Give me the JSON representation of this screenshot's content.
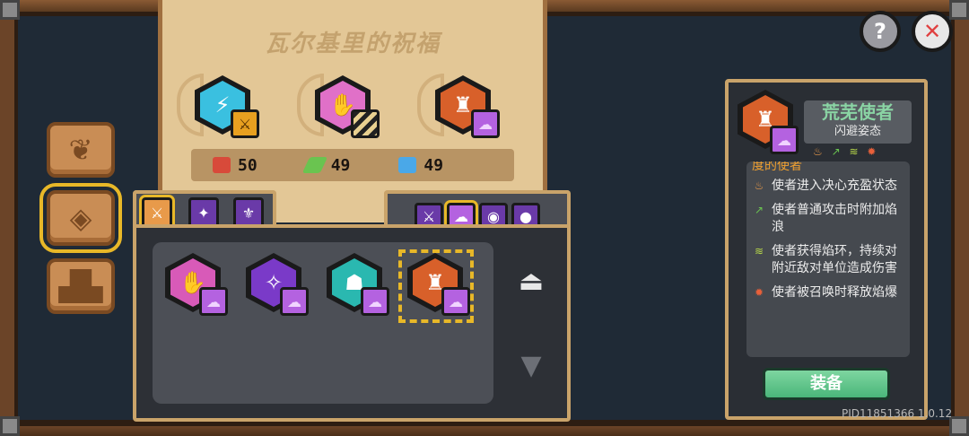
{
  "blessing": {
    "title": "瓦尔基里的祝福",
    "slots": [
      {
        "icon": "lightning-hex-icon",
        "badge": "sword-badge-icon"
      },
      {
        "icon": "pink-hand-hex-icon",
        "badge": "striped-badge-icon"
      },
      {
        "icon": "fire-envoy-hex-icon",
        "badge": "purple-cloud-badge-icon"
      }
    ],
    "stats": [
      {
        "icon": "red-gem-icon",
        "value": "50",
        "color": "#d84a3a"
      },
      {
        "icon": "green-leaf-icon",
        "value": "49",
        "color": "#6ac450"
      },
      {
        "icon": "blue-book-icon",
        "value": "49",
        "color": "#4aa8e8"
      }
    ]
  },
  "panel": {
    "runes": [
      {
        "icon": "pink-hand-rune-icon",
        "color": "#d85ab8"
      },
      {
        "icon": "purple-star-rune-icon",
        "color": "#7a3ac8"
      },
      {
        "icon": "teal-figure-rune-icon",
        "color": "#2ab8b0"
      },
      {
        "icon": "fire-envoy-rune-icon",
        "color": "#d8602a",
        "selected": true
      }
    ]
  },
  "detail": {
    "name": "荒芜使者",
    "subtitle": "闪避姿态",
    "description_heading": "度的使者",
    "effects": [
      {
        "icon": "flame-icon",
        "text": "使者进入决心充盈状态",
        "color": "#e89a4a"
      },
      {
        "icon": "arrow-icon",
        "text": "使者普通攻击时附加焰浪",
        "color": "#6ac450"
      },
      {
        "icon": "wave-icon",
        "text": "使者获得焰环，持续对附近敌对单位造成伤害",
        "color": "#b8d84a"
      },
      {
        "icon": "burst-icon",
        "text": "使者被召唤时释放焰爆",
        "color": "#e8603a"
      }
    ],
    "equip_label": "装备"
  },
  "top_buttons": {
    "help_label": "?",
    "close_label": "✕"
  },
  "version": "PID11851366 1.0.12"
}
